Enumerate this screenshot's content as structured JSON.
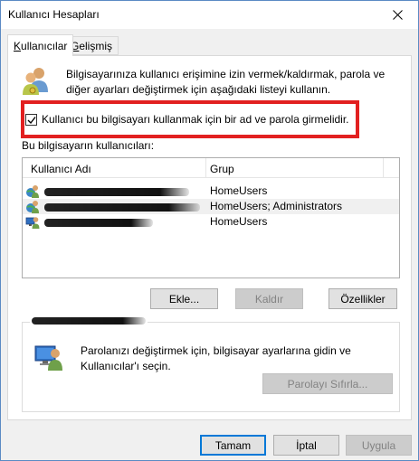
{
  "window": {
    "title": "Kullanıcı Hesapları"
  },
  "tabs": [
    {
      "label_underline": "K",
      "label_rest": "ullanıcılar",
      "active": true
    },
    {
      "label_underline": "G",
      "label_rest": "elişmiş",
      "active": false
    }
  ],
  "intro": {
    "text": "Bilgisayarınıza kullanıcı erişimine izin vermek/kaldırmak, parola ve diğer ayarları değiştirmek için aşağıdaki listeyi kullanın."
  },
  "require_password": {
    "label": "Kullanıcı bu bilgisayarı kullanmak için bir ad ve parola girmelidir.",
    "checked": true
  },
  "users_list": {
    "label": "Bu bilgisayarın kullanıcıları:",
    "columns": [
      "Kullanıcı Adı",
      "Grup"
    ],
    "rows": [
      {
        "name_redacted": true,
        "group": "HomeUsers",
        "selected": false
      },
      {
        "name_redacted": true,
        "group": "HomeUsers; Administrators",
        "selected": true
      },
      {
        "name_redacted": true,
        "group": "HomeUsers",
        "selected": false
      }
    ]
  },
  "list_buttons": {
    "add": "Ekle...",
    "remove": "Kaldır",
    "properties": "Özellikler"
  },
  "password_box": {
    "title_redacted": true,
    "text": "Parolanızı değiştirmek için, bilgisayar ayarlarına gidin ve Kullanıcılar'ı seçin.",
    "reset_button": "Parolayı Sıfırla..."
  },
  "footer_buttons": {
    "ok": "Tamam",
    "cancel": "İptal",
    "apply": "Uygula"
  },
  "colors": {
    "highlight_border": "#e22020",
    "window_border": "#5b8ac4"
  }
}
